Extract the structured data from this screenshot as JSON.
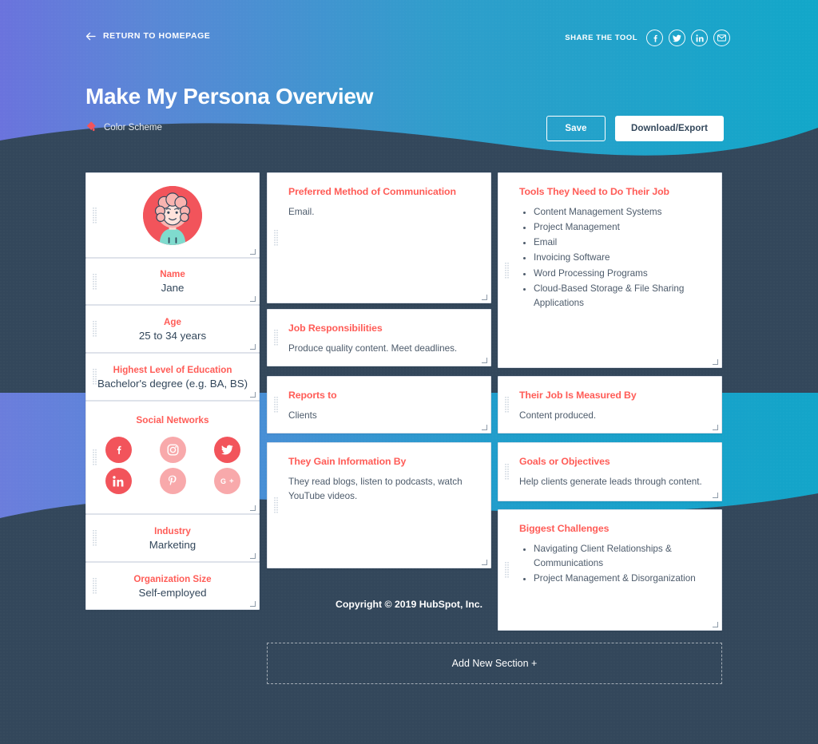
{
  "header": {
    "return_label": "RETURN TO HOMEPAGE",
    "back_arrow_icon": "arrow-left-icon",
    "share_label": "SHARE THE TOOL",
    "share_buttons": [
      {
        "icon": "facebook-icon",
        "name": "facebook"
      },
      {
        "icon": "twitter-icon",
        "name": "twitter"
      },
      {
        "icon": "linkedin-icon",
        "name": "linkedin"
      },
      {
        "icon": "email-icon",
        "name": "email"
      }
    ],
    "title": "Make My Persona Overview",
    "color_scheme_label": "Color Scheme",
    "color_scheme_icon": "paint-drop-icon",
    "save_label": "Save",
    "download_label": "Download/Export"
  },
  "profile": {
    "avatar_icon": "persona-avatar-illustration",
    "fields": [
      {
        "label": "Name",
        "value": "Jane"
      },
      {
        "label": "Age",
        "value": "25 to 34 years"
      },
      {
        "label": "Highest Level of Education",
        "value": "Bachelor's degree (e.g. BA, BS)"
      },
      {
        "label": "Industry",
        "value": "Marketing"
      },
      {
        "label": "Organization Size",
        "value": "Self-employed"
      }
    ],
    "social": {
      "title": "Social Networks",
      "networks": [
        {
          "name": "facebook",
          "icon": "facebook-icon",
          "active": true
        },
        {
          "name": "instagram",
          "icon": "instagram-icon",
          "active": false
        },
        {
          "name": "twitter",
          "icon": "twitter-icon",
          "active": true
        },
        {
          "name": "linkedin",
          "icon": "linkedin-icon",
          "active": true
        },
        {
          "name": "pinterest",
          "icon": "pinterest-icon",
          "active": false
        },
        {
          "name": "googleplus",
          "icon": "google-plus-icon",
          "active": false
        }
      ]
    }
  },
  "cards": {
    "communication": {
      "title": "Preferred Method of Communication",
      "body": "Email."
    },
    "responsibilities": {
      "title": "Job Responsibilities",
      "body": "Produce quality content. Meet deadlines."
    },
    "reports_to": {
      "title": "Reports to",
      "body": "Clients"
    },
    "gain_information": {
      "title": "They Gain Information By",
      "body": "They read blogs, listen to podcasts, watch YouTube videos."
    },
    "tools": {
      "title": "Tools They Need to Do Their Job",
      "items": [
        "Content Management Systems",
        "Project Management",
        "Email",
        "Invoicing Software",
        "Word Processing Programs",
        "Cloud-Based Storage & File Sharing Applications"
      ]
    },
    "measured_by": {
      "title": "Their Job Is Measured By",
      "body": "Content produced."
    },
    "goals": {
      "title": "Goals or Objectives",
      "body": "Help clients generate leads through content."
    },
    "challenges": {
      "title": "Biggest Challenges",
      "items": [
        "Navigating Client Relationships & Communications",
        "Project Management & Disorganization"
      ]
    }
  },
  "add_section": {
    "label": "Add New Section +"
  },
  "footer": {
    "copyright": "Copyright © 2019 HubSpot, Inc."
  },
  "colors": {
    "accent_red": "#ff5c57",
    "dark_navy": "#33475b",
    "cyan": "#1a9cc7",
    "purple_blue": "#6580dd",
    "text_body": "#4d5b6b"
  }
}
